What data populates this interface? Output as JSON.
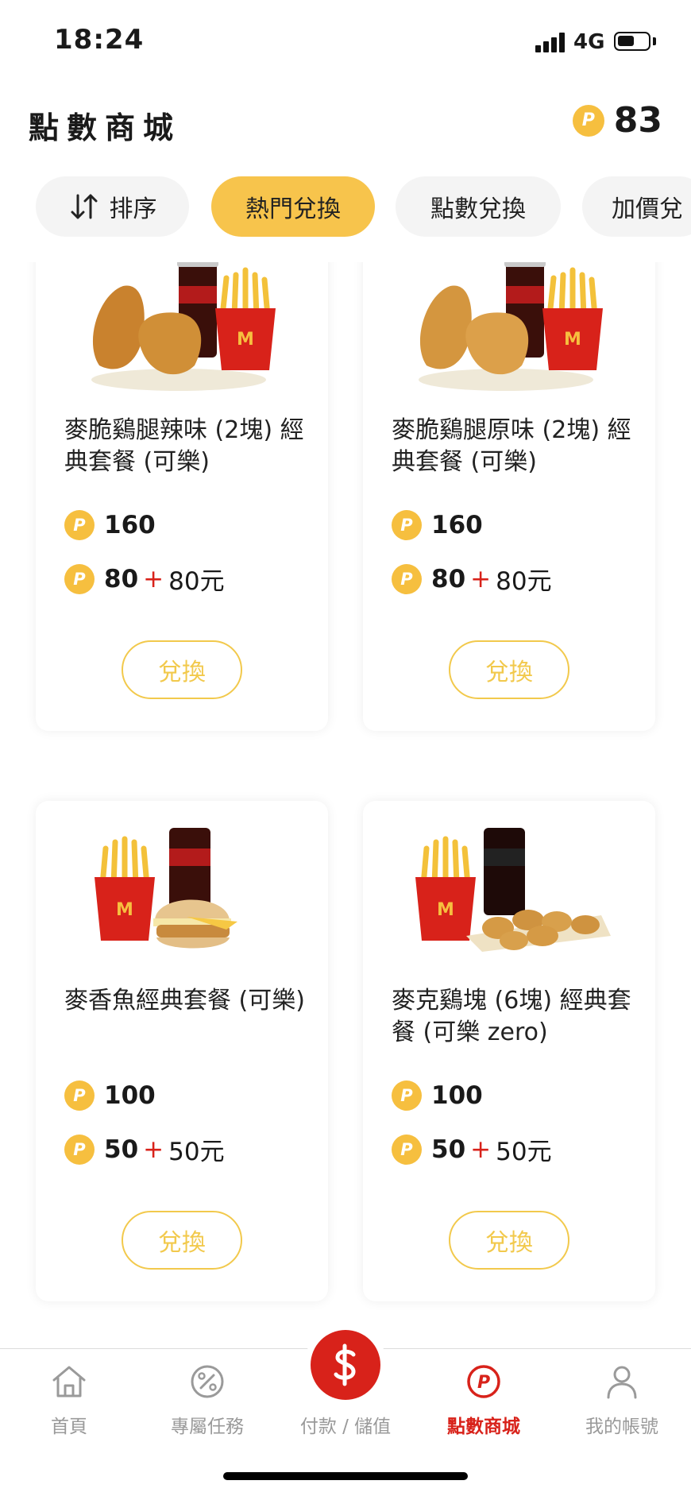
{
  "status_bar": {
    "time": "18:24",
    "network": "4G",
    "icons": [
      "signal-icon",
      "battery-icon"
    ]
  },
  "header": {
    "title": "點數商城",
    "points_balance": "83",
    "coin_symbol": "P"
  },
  "filters": {
    "sort_label": "排序",
    "chips": [
      "熱門兌換",
      "點數兌換",
      "加價兌"
    ],
    "active_chip": "熱門兌換"
  },
  "products": [
    {
      "name": "麥脆鷄腿辣味 (2塊) 經典套餐 (可樂)",
      "points": "160",
      "combo_points": "80",
      "plus": "+",
      "cash": "80元",
      "button_label": "兌換",
      "image_icon": "chicken-meal-image"
    },
    {
      "name": "麥脆鷄腿原味 (2塊) 經典套餐 (可樂)",
      "points": "160",
      "combo_points": "80",
      "plus": "+",
      "cash": "80元",
      "button_label": "兌換",
      "image_icon": "chicken-meal-image"
    },
    {
      "name": "麥香魚經典套餐 (可樂)",
      "points": "100",
      "combo_points": "50",
      "plus": "+",
      "cash": "50元",
      "button_label": "兌換",
      "image_icon": "fish-burger-meal-image"
    },
    {
      "name": "麥克鷄塊 (6塊) 經典套餐 (可樂 zero)",
      "points": "100",
      "combo_points": "50",
      "plus": "+",
      "cash": "50元",
      "button_label": "兌換",
      "image_icon": "nuggets-meal-image"
    }
  ],
  "bottom_nav": {
    "items": [
      {
        "label": "首頁",
        "icon": "home-icon"
      },
      {
        "label": "專屬任務",
        "icon": "percent-badge-icon"
      },
      {
        "label": "付款 / 儲值",
        "icon": "dollar-icon"
      },
      {
        "label": "點數商城",
        "icon": "points-icon"
      },
      {
        "label": "我的帳號",
        "icon": "user-icon"
      }
    ],
    "active": "點數商城"
  },
  "colors": {
    "accent_yellow": "#f7c44c",
    "brand_red": "#d8221a",
    "chip_bg": "#f4f4f4",
    "inactive_gray": "#9a9a9a"
  }
}
